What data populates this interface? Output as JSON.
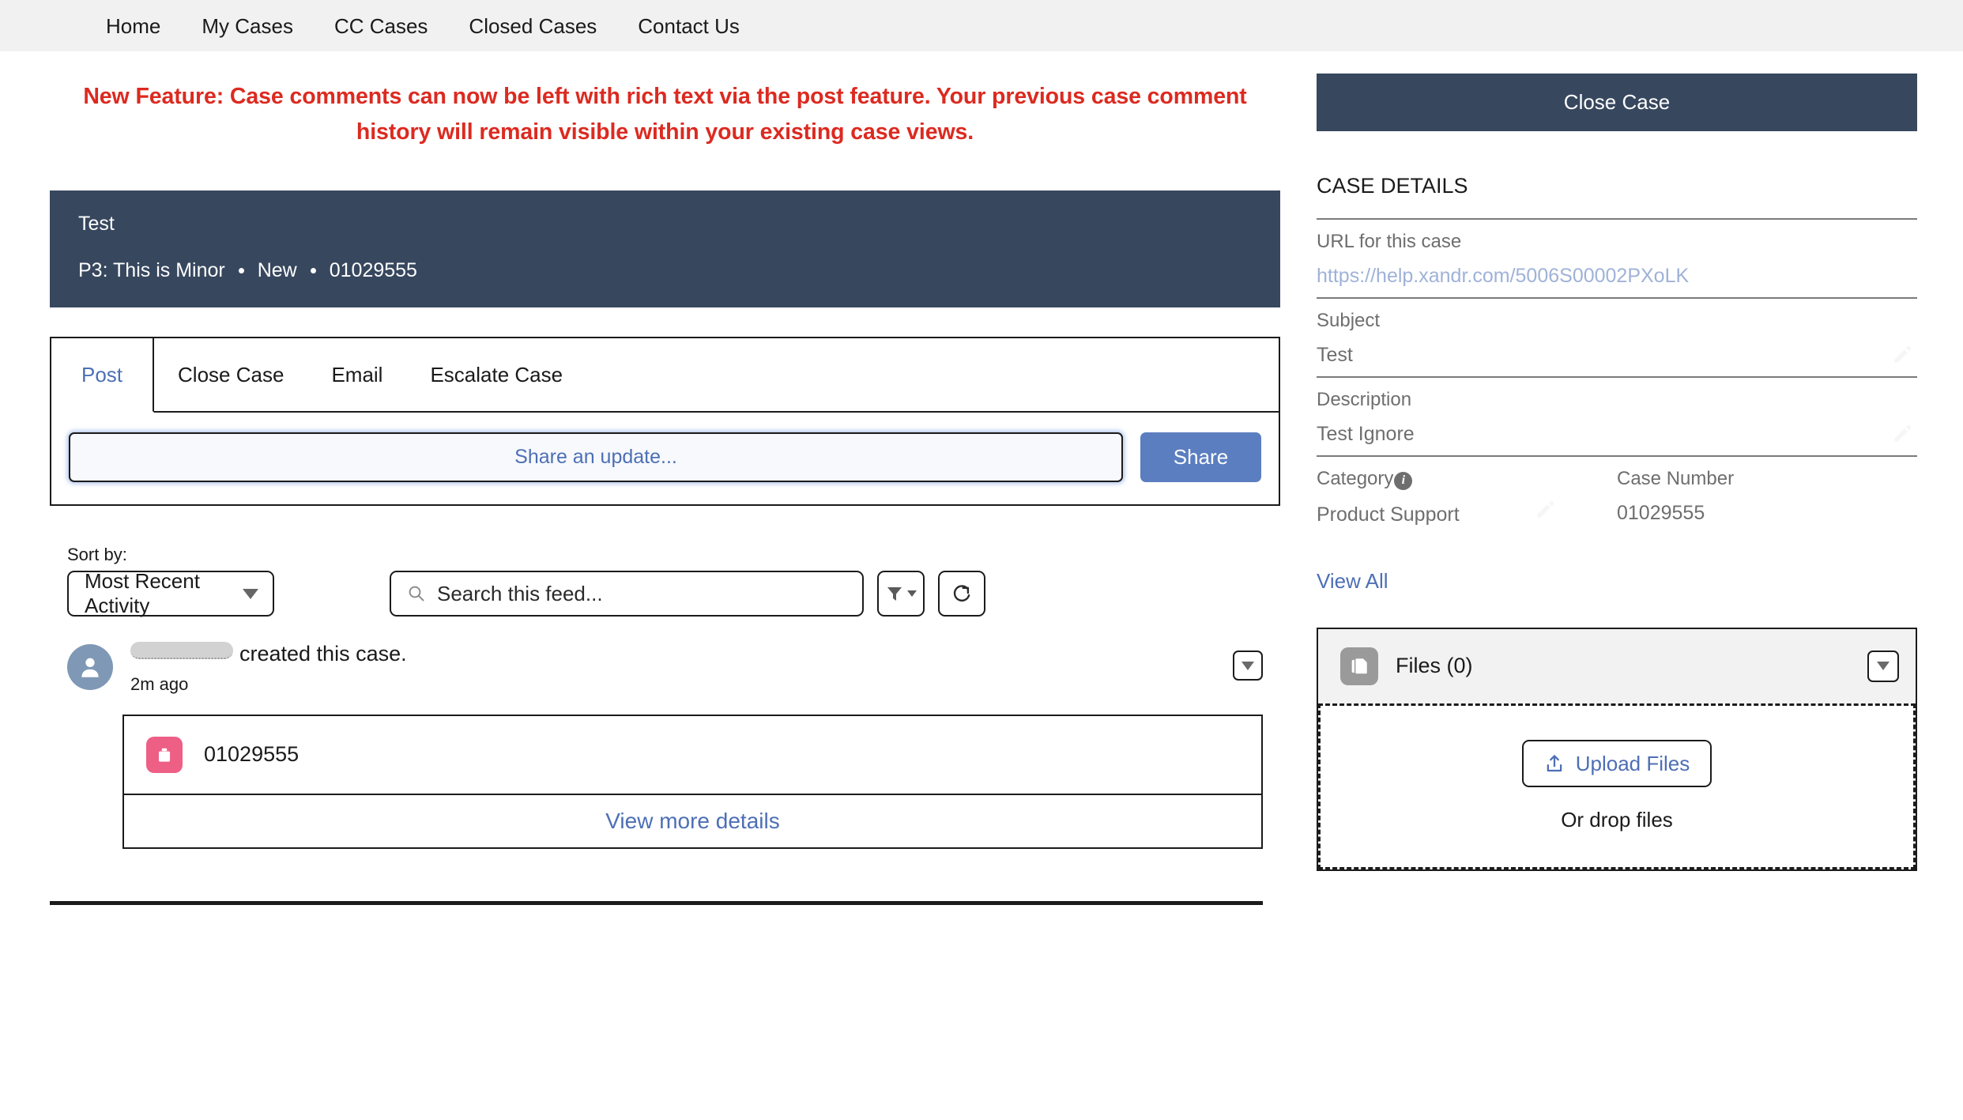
{
  "topnav": {
    "items": [
      {
        "label": "Home"
      },
      {
        "label": "My Cases"
      },
      {
        "label": "CC Cases"
      },
      {
        "label": "Closed Cases"
      },
      {
        "label": "Contact Us"
      }
    ]
  },
  "banner": {
    "text": "New Feature: Case comments can now be left with rich text via the post feature. Your previous case comment history will remain visible within your existing case views.",
    "color": "#dc2a20"
  },
  "case_header": {
    "title": "Test",
    "priority": "P3: This is Minor",
    "status": "New",
    "case_number": "01029555",
    "background": "#37475e"
  },
  "publisher": {
    "tabs": [
      {
        "label": "Post",
        "active": true
      },
      {
        "label": "Close Case",
        "active": false
      },
      {
        "label": "Email",
        "active": false
      },
      {
        "label": "Escalate Case",
        "active": false
      }
    ],
    "composer_placeholder": "Share an update...",
    "share_label": "Share",
    "share_color": "#5b7ec0"
  },
  "feed_tools": {
    "sort_label": "Sort by:",
    "sort_value": "Most Recent Activity",
    "search_placeholder": "Search this feed...",
    "filter_icon": "filter-icon",
    "refresh_icon": "refresh-icon"
  },
  "feed": {
    "item": {
      "author": "",
      "action_text": "created this case.",
      "timestamp": "2m ago",
      "record_number": "01029555",
      "view_more_label": "View more details",
      "case_icon_color": "#ee5f85"
    }
  },
  "right_panel": {
    "close_case_label": "Close Case",
    "details_title": "CASE DETAILS",
    "fields": [
      {
        "label": "URL for this case",
        "value": "https://help.xandr.com/5006S00002PXoLK",
        "is_link": true
      },
      {
        "label": "Subject",
        "value": "Test",
        "editable": true
      },
      {
        "label": "Description",
        "value": "Test Ignore",
        "editable": true
      }
    ],
    "category": {
      "label": "Category",
      "value": "Product Support",
      "has_info": true
    },
    "case_number": {
      "label": "Case Number",
      "value": "01029555"
    },
    "view_all_label": "View All",
    "files": {
      "title": "Files (0)",
      "upload_label": "Upload Files",
      "drop_hint": "Or drop files"
    }
  }
}
